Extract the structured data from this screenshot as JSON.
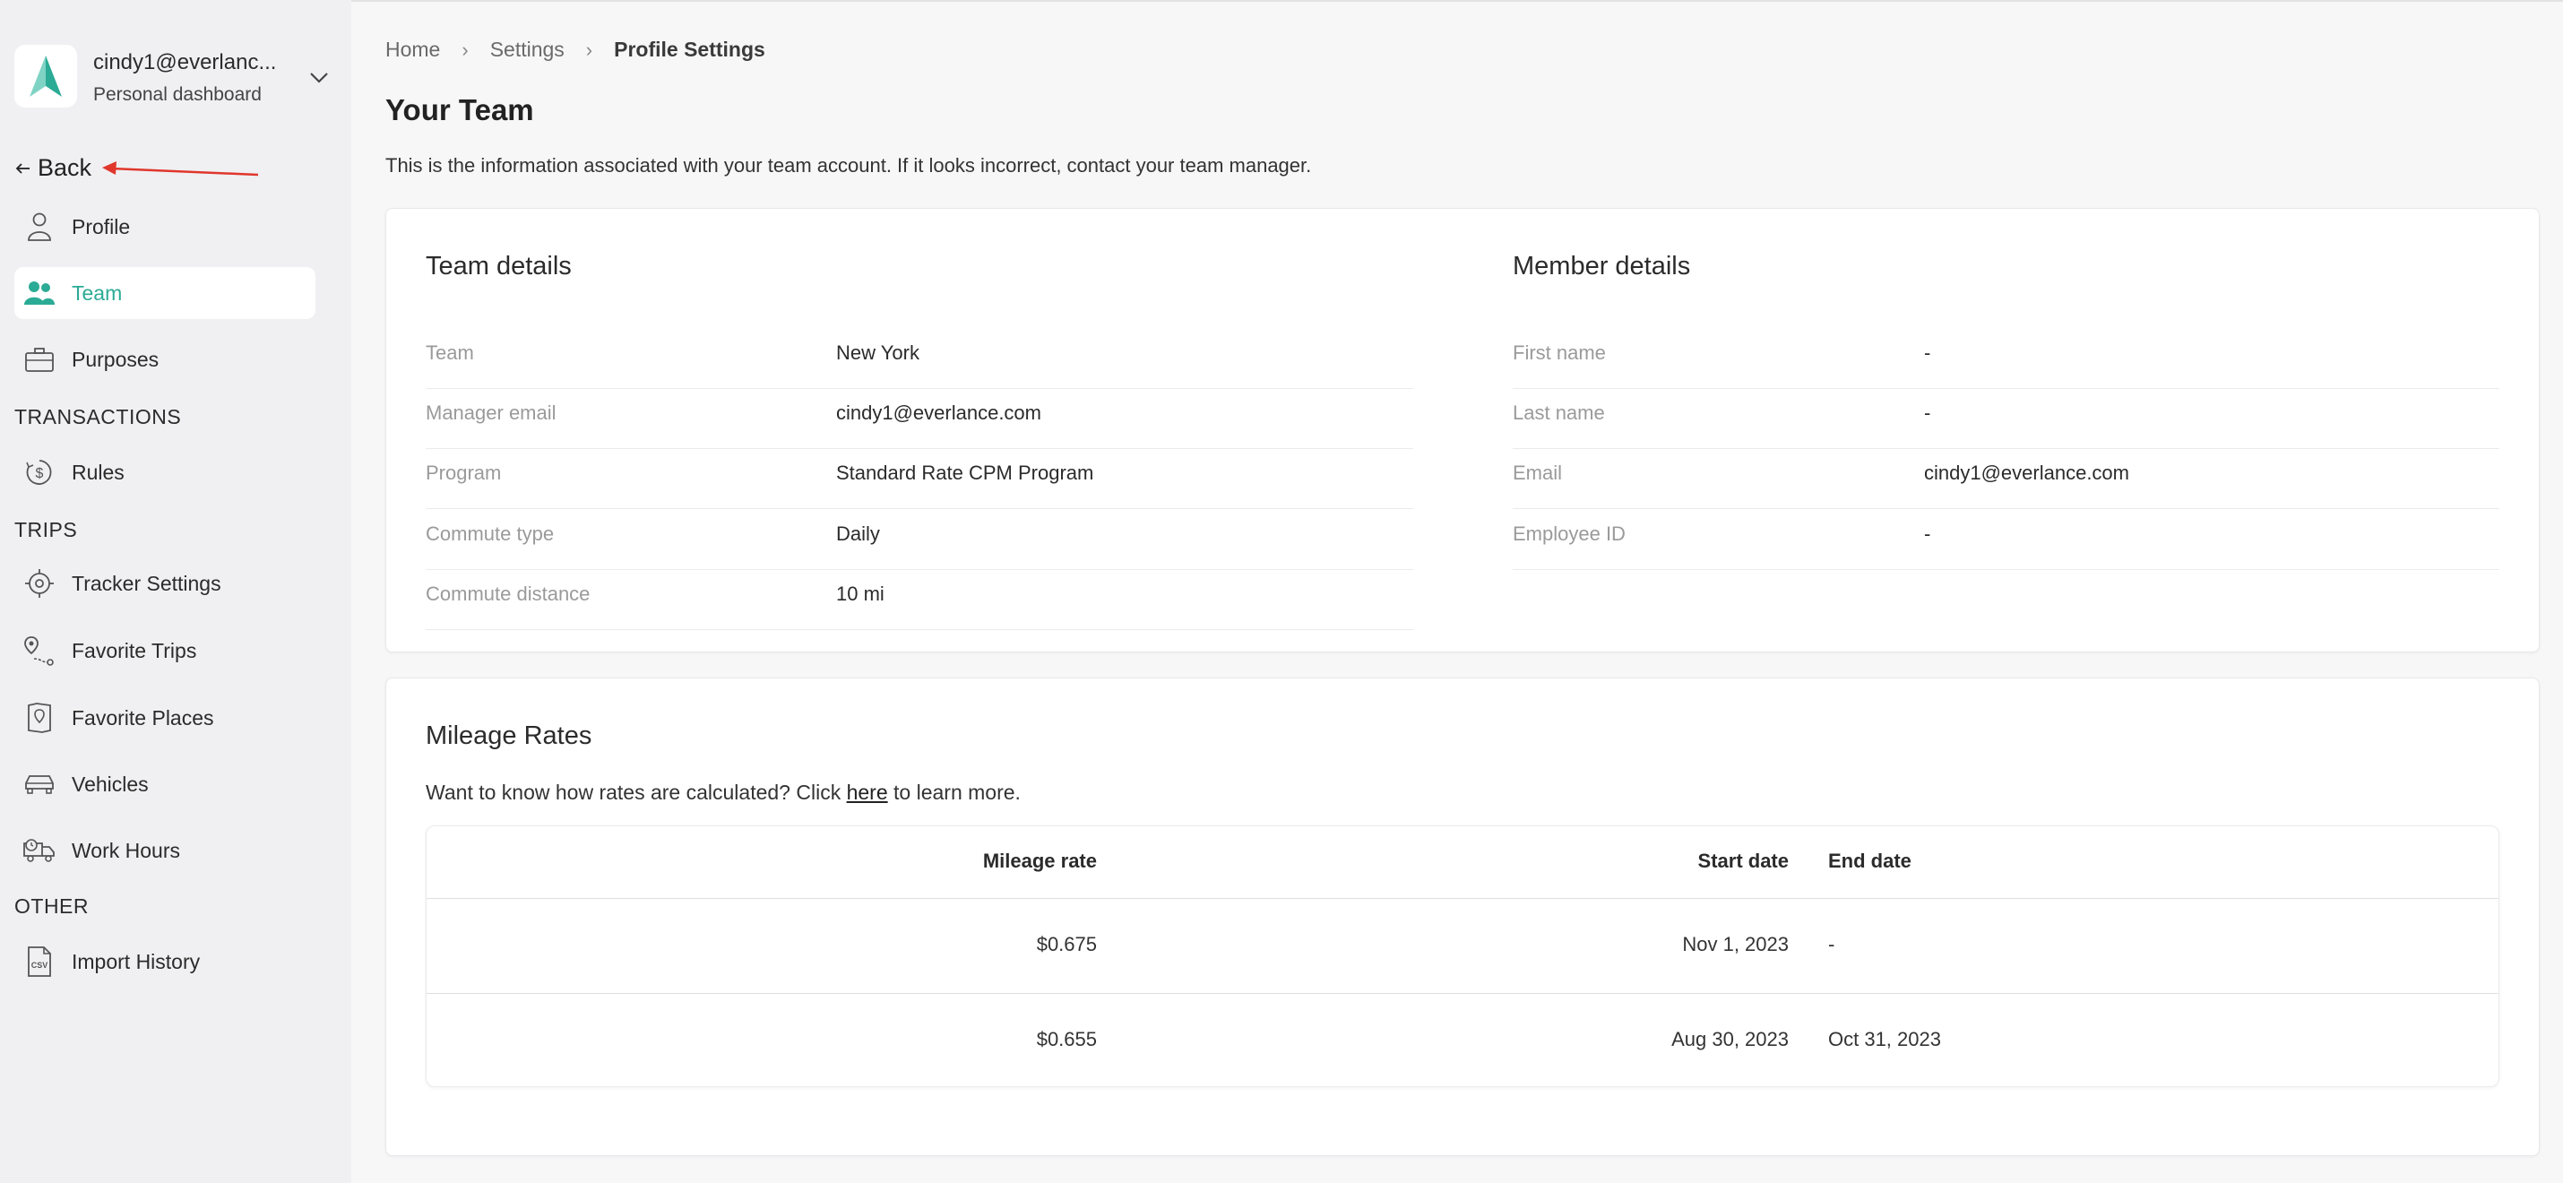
{
  "account": {
    "email": "cindy1@everlanc...",
    "subtitle": "Personal dashboard"
  },
  "back_label": "Back",
  "nav": {
    "profile": "Profile",
    "team": "Team",
    "purposes": "Purposes",
    "section_transactions": "TRANSACTIONS",
    "rules": "Rules",
    "section_trips": "TRIPS",
    "tracker_settings": "Tracker Settings",
    "favorite_trips": "Favorite Trips",
    "favorite_places": "Favorite Places",
    "vehicles": "Vehicles",
    "work_hours": "Work Hours",
    "section_other": "OTHER",
    "import_history": "Import History"
  },
  "breadcrumb": {
    "home": "Home",
    "settings": "Settings",
    "current": "Profile Settings"
  },
  "page": {
    "title": "Your Team",
    "description": "This is the information associated with your team account. If it looks incorrect, contact your team manager."
  },
  "team_details": {
    "heading": "Team details",
    "rows": [
      {
        "label": "Team",
        "value": "New York"
      },
      {
        "label": "Manager email",
        "value": "cindy1@everlance.com"
      },
      {
        "label": "Program",
        "value": "Standard Rate CPM Program"
      },
      {
        "label": "Commute type",
        "value": "Daily"
      },
      {
        "label": "Commute distance",
        "value": "10 mi"
      }
    ]
  },
  "member_details": {
    "heading": "Member details",
    "rows": [
      {
        "label": "First name",
        "value": "-"
      },
      {
        "label": "Last name",
        "value": "-"
      },
      {
        "label": "Email",
        "value": "cindy1@everlance.com"
      },
      {
        "label": "Employee ID",
        "value": "-"
      }
    ]
  },
  "mileage_rates": {
    "heading": "Mileage Rates",
    "desc_before": "Want to know how rates are calculated? Click ",
    "desc_link": "here",
    "desc_after": " to learn more.",
    "columns": {
      "rate": "Mileage rate",
      "start": "Start date",
      "end": "End date"
    },
    "rows": [
      {
        "rate": "$0.675",
        "start": "Nov 1, 2023",
        "end": "-"
      },
      {
        "rate": "$0.655",
        "start": "Aug 30, 2023",
        "end": "Oct 31, 2023"
      }
    ]
  },
  "colors": {
    "accent": "#2bab95",
    "annotation_arrow": "#e0362c"
  }
}
